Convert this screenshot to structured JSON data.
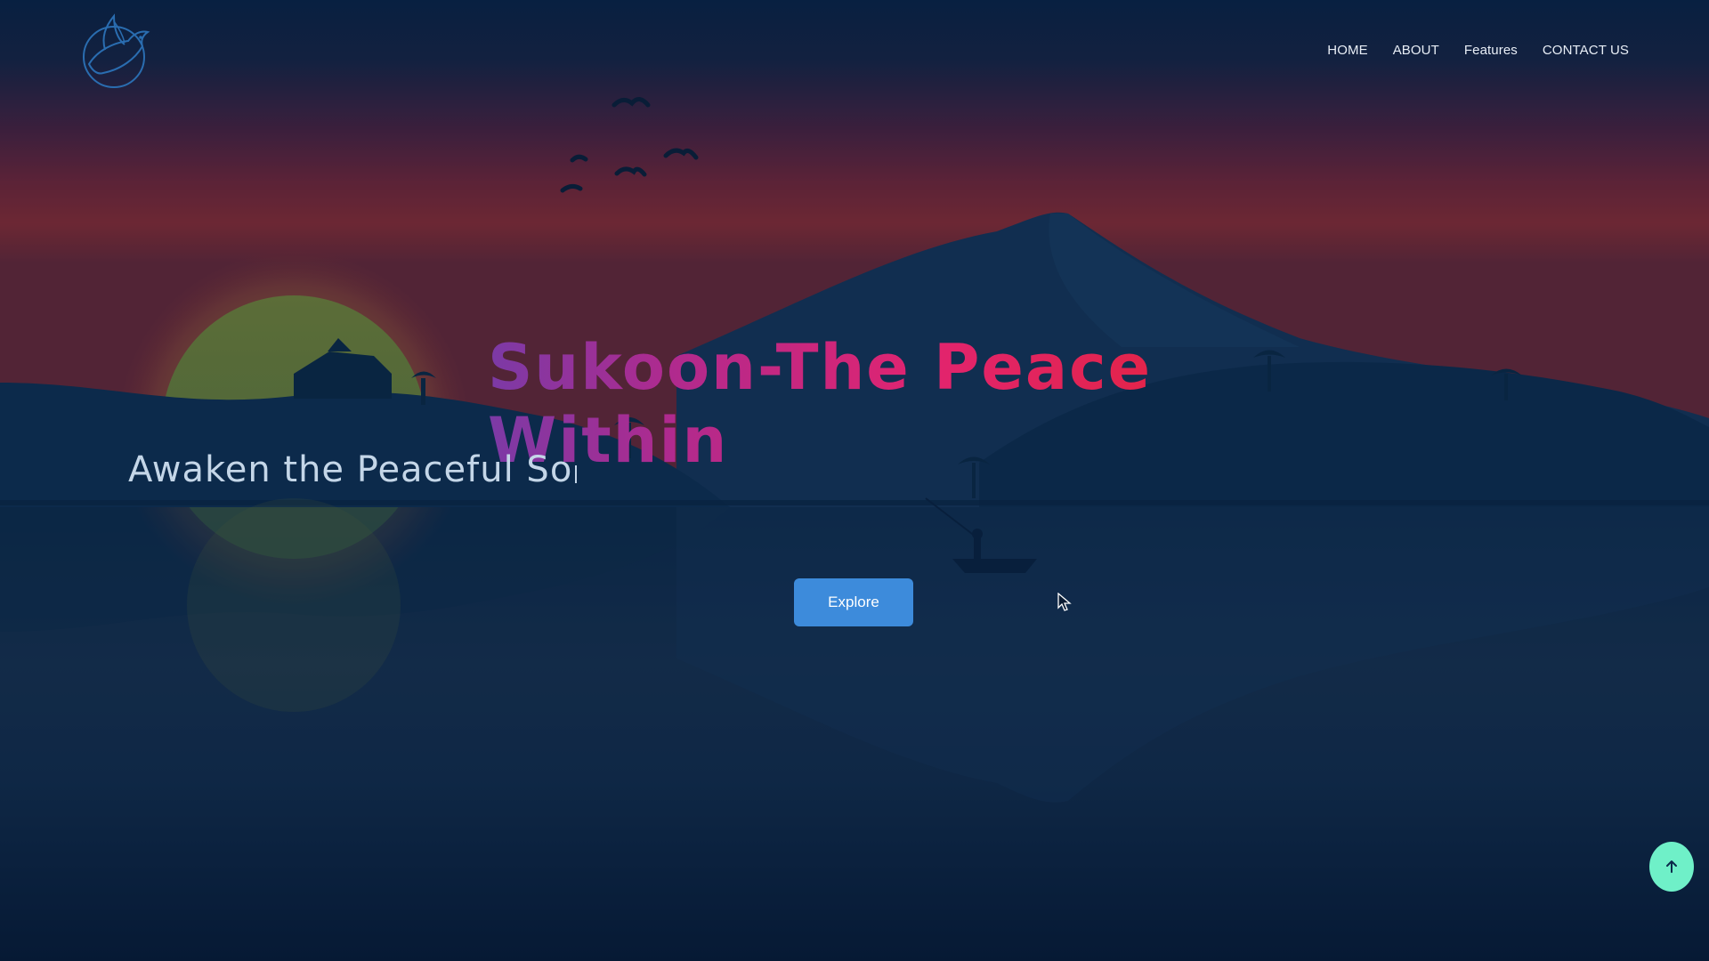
{
  "nav": {
    "items": [
      {
        "label": "HOME"
      },
      {
        "label": "ABOUT"
      },
      {
        "label": "Features"
      },
      {
        "label": "CONTACT US"
      }
    ]
  },
  "hero": {
    "title": "Sukoon-The Peace Within",
    "typed_text": "Awaken the Peaceful So",
    "cta_label": "Explore"
  },
  "icons": {
    "logo": "dove-icon",
    "scroll_top": "arrow-up-icon",
    "pointer": "mouse-cursor-icon"
  },
  "colors": {
    "title_gradient_start": "#7b3aa6",
    "title_gradient_end": "#e3243f",
    "cta_background": "#3d8bdb",
    "scroll_top_background": "#6ff0c8"
  }
}
